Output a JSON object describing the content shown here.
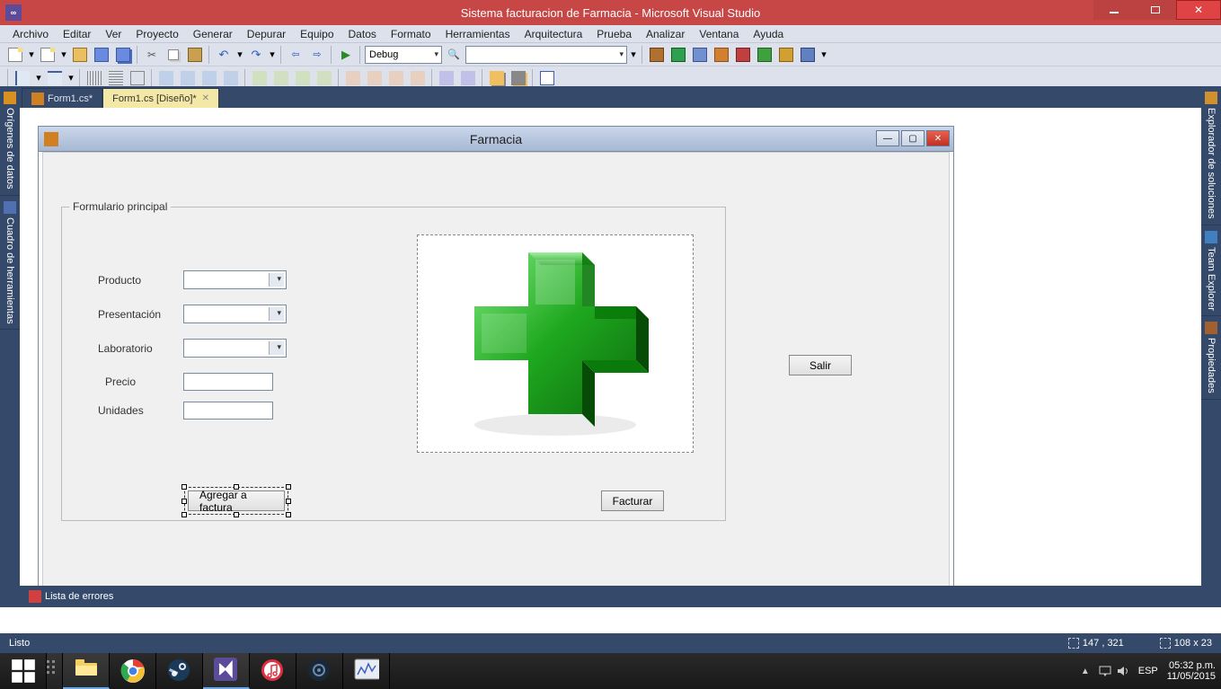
{
  "window": {
    "title": "Sistema facturacion de Farmacia - Microsoft Visual Studio"
  },
  "menubar": {
    "items": {
      "0": "Archivo",
      "1": "Editar",
      "2": "Ver",
      "3": "Proyecto",
      "4": "Generar",
      "5": "Depurar",
      "6": "Equipo",
      "7": "Datos",
      "8": "Formato",
      "9": "Herramientas",
      "10": "Arquitectura",
      "11": "Prueba",
      "12": "Analizar",
      "13": "Ventana",
      "14": "Ayuda"
    }
  },
  "toolbar": {
    "config": "Debug",
    "search": ""
  },
  "left_tabs": {
    "0": "Orígenes de datos",
    "1": "Cuadro de herramientas"
  },
  "right_tabs": {
    "0": "Explorador de soluciones",
    "1": "Team Explorer",
    "2": "Propiedades"
  },
  "doc_tabs": {
    "0": "Form1.cs*",
    "1": "Form1.cs [Diseño]*"
  },
  "designer": {
    "form_title": "Farmacia",
    "group_title": "Formulario principal",
    "labels": {
      "producto": "Producto",
      "presentacion": "Presentación",
      "laboratorio": "Laboratorio",
      "precio": "Precio",
      "unidades": "Unidades"
    },
    "buttons": {
      "agregar": "Agregar a factura",
      "facturar": "Facturar",
      "salir": "Salir"
    }
  },
  "bottom_tab": "Lista de errores",
  "statusbar": {
    "ready": "Listo",
    "pos": "147 , 321",
    "size": "108 x 23"
  },
  "tray": {
    "lang": "ESP",
    "time": "05:32 p.m.",
    "date": "11/05/2015"
  }
}
